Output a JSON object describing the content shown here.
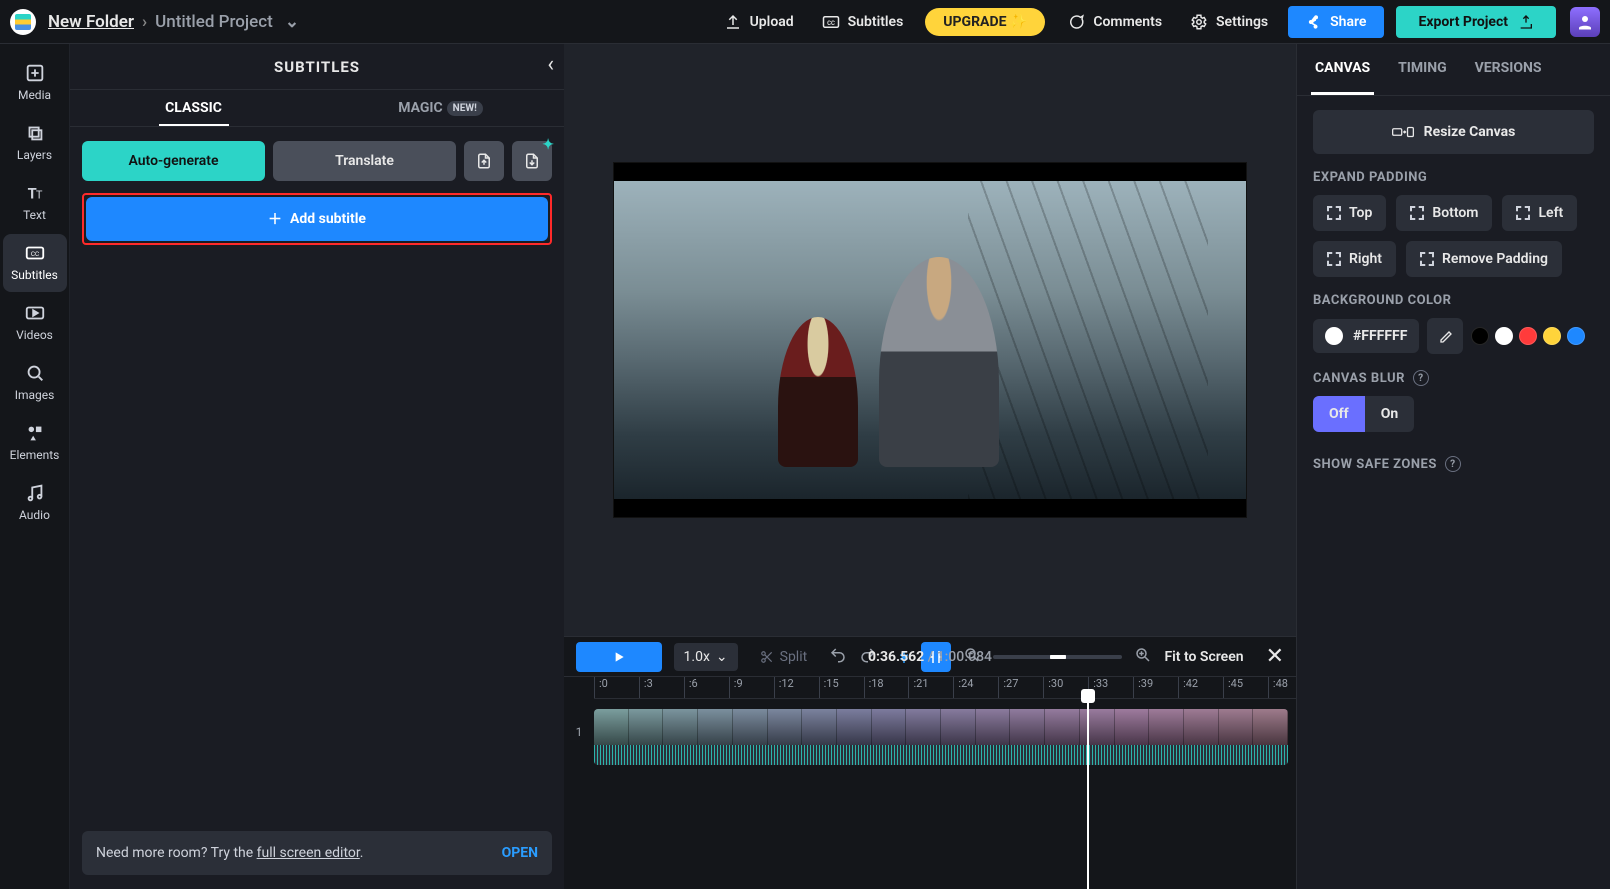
{
  "breadcrumb": {
    "folder": "New Folder",
    "project": "Untitled Project"
  },
  "topbar": {
    "upload": "Upload",
    "subtitles": "Subtitles",
    "upgrade": "UPGRADE ✨",
    "comments": "Comments",
    "settings": "Settings",
    "share": "Share",
    "export": "Export Project"
  },
  "rail": [
    {
      "key": "media",
      "label": "Media"
    },
    {
      "key": "layers",
      "label": "Layers"
    },
    {
      "key": "text",
      "label": "Text"
    },
    {
      "key": "subtitles",
      "label": "Subtitles"
    },
    {
      "key": "videos",
      "label": "Videos"
    },
    {
      "key": "images",
      "label": "Images"
    },
    {
      "key": "elements",
      "label": "Elements"
    },
    {
      "key": "audio",
      "label": "Audio"
    }
  ],
  "panel": {
    "title": "SUBTITLES",
    "tabs": {
      "classic": "CLASSIC",
      "magic": "MAGIC",
      "new_badge": "NEW!"
    },
    "buttons": {
      "auto": "Auto-generate",
      "translate": "Translate",
      "add": "Add subtitle"
    },
    "hint": {
      "prefix": "Need more room? Try the ",
      "link": "full screen editor",
      "suffix": ".",
      "open": "OPEN"
    }
  },
  "inspector": {
    "tabs": [
      "CANVAS",
      "TIMING",
      "VERSIONS"
    ],
    "resize": "Resize Canvas",
    "expand_title": "EXPAND PADDING",
    "padding": {
      "top": "Top",
      "bottom": "Bottom",
      "left": "Left",
      "right": "Right",
      "remove": "Remove Padding"
    },
    "bg_title": "BACKGROUND COLOR",
    "bg_value": "#FFFFFF",
    "swatches": [
      "#000000",
      "#ffffff",
      "#ff3b3b",
      "#ffd43b",
      "#1e88ff"
    ],
    "blur_title": "CANVAS BLUR",
    "blur": {
      "off": "Off",
      "on": "On"
    },
    "safe_title": "SHOW SAFE ZONES"
  },
  "timeline": {
    "speed": "1.0x",
    "split": "Split",
    "current": "0:36.562",
    "duration": "1:00.084",
    "fit": "Fit to Screen",
    "ticks": [
      ":0",
      ":3",
      ":6",
      ":9",
      ":12",
      ":15",
      ":18",
      ":21",
      ":24",
      ":27",
      ":30",
      ":33",
      ":39",
      ":42",
      ":45",
      ":48"
    ],
    "playhead_pct": 67.4,
    "track_label": "1"
  }
}
